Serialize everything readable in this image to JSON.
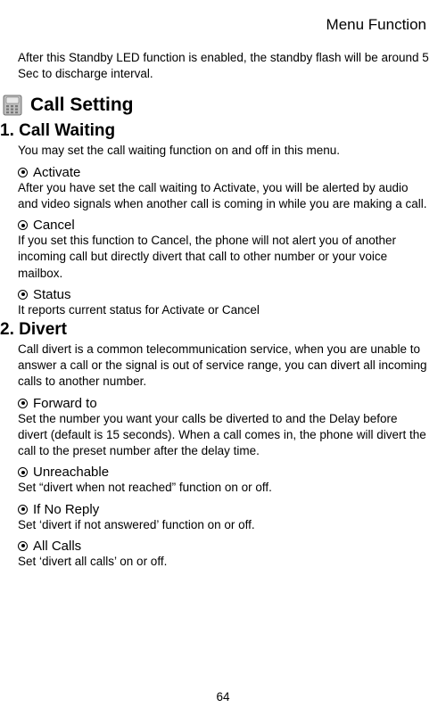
{
  "header": {
    "running_title": "Menu Function"
  },
  "intro": "After this Standby LED function is enabled, the standby flash will be around 5 Sec to discharge interval.",
  "section": {
    "title": "Call Setting"
  },
  "s1": {
    "heading": "1. Call Waiting",
    "desc": "You may set the call waiting function on and off in this menu.",
    "items": [
      {
        "label": "Activate",
        "desc": "After you have set the call waiting to Activate, you will be alerted by audio and video signals when another call is coming in while you are making a call."
      },
      {
        "label": "Cancel",
        "desc": "If you set this function to Cancel, the phone will not alert you of another incoming call but directly divert that call to other number or your voice mailbox."
      },
      {
        "label": "Status",
        "desc": "It reports current status for Activate or Cancel"
      }
    ]
  },
  "s2": {
    "heading": "2. Divert",
    "desc": "Call divert is a common telecommunication service, when you are unable to answer a call or the signal is out of service range, you can divert all incoming calls to another number.",
    "items": [
      {
        "label": "Forward to",
        "desc": "Set the number you want your calls be diverted to and the Delay before divert (default is 15 seconds). When a call comes in, the phone will divert the call to the preset number after the delay time."
      },
      {
        "label": "Unreachable",
        "desc": "Set “divert when not reached” function on or off."
      },
      {
        "label": "If No Reply",
        "desc": "Set ‘divert if not answered’ function on or off."
      },
      {
        "label": "All Calls",
        "desc": "Set ‘divert all calls’ on or off."
      }
    ]
  },
  "page_number": "64"
}
